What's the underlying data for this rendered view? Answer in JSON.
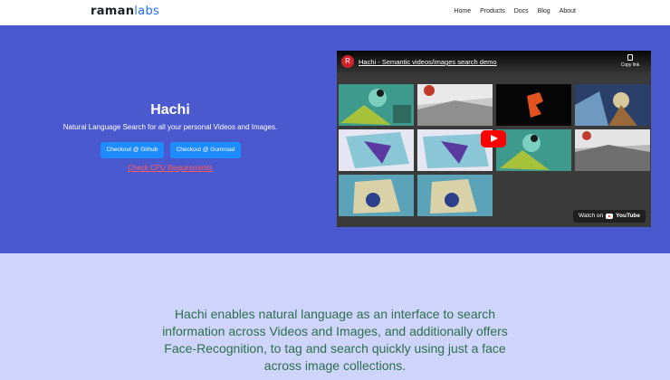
{
  "brand": {
    "part1": "raman",
    "part2": "labs"
  },
  "nav": {
    "items": [
      "Home",
      "Products",
      "Docs",
      "Blog",
      "About"
    ]
  },
  "hero": {
    "title": "Hachi",
    "subtitle": "Natural Language Search for all your personal Videos and Images.",
    "github_button": "Checkout @ Github",
    "gumroad_button": "Checkout @ Gumroad",
    "cpu_link": "Check CPU Requirements"
  },
  "video": {
    "channel_avatar_letter": "R",
    "title": "Hachi - Semantic videos/images search demo",
    "copy_link": "Copy link",
    "watch_on": "Watch on",
    "youtube_word": "YouTube"
  },
  "description": "Hachi enables natural language as an interface to search information across Videos and Images, and additionally offers Face-Recognition, to tag and search quickly using just a face across image collections.",
  "colors": {
    "hero_bg": "#4b59cf",
    "lower_bg": "#cfd4fb",
    "button": "#1e8bff",
    "link": "#ff5a5a",
    "desc_text": "#2c6e4d",
    "yt_red": "#ff0000"
  }
}
